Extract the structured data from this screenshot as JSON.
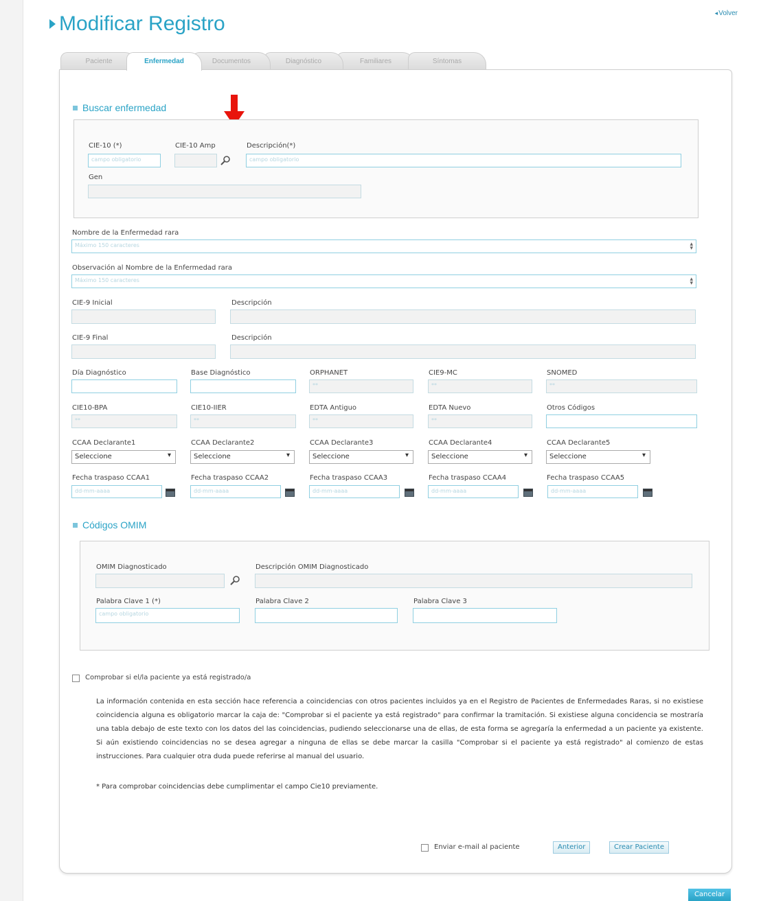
{
  "header": {
    "title": "Modificar Registro",
    "back_link": "Volver"
  },
  "tabs": [
    "Paciente",
    "Enfermedad",
    "Documentos",
    "Diagnóstico",
    "Familiares",
    "Síntomas"
  ],
  "buscar": {
    "section_title": "Buscar enfermedad",
    "cie10_label": "CIE-10 (*)",
    "cie10_placeholder": "campo obligatorio",
    "cie10amp_label": "CIE-10 Amp",
    "descripcion_label": "Descripción(*)",
    "descripcion_placeholder": "campo obligatorio",
    "gen_label": "Gen"
  },
  "form": {
    "nombre_label": "Nombre de la Enfermedad rara",
    "nombre_placeholder": "Máximo 150 caracteres",
    "observacion_label": "Observación al Nombre de la Enfermedad rara",
    "observacion_placeholder": "Máximo 150 caracteres",
    "cie9_inicial_label": "CIE-9 Inicial",
    "cie9_final_label": "CIE-9 Final",
    "descripcion_label": "Descripción",
    "row1": [
      "Día Diagnóstico",
      "Base Diagnóstico",
      "ORPHANET",
      "CIE9-MC",
      "SNOMED"
    ],
    "row1_values": [
      "",
      "",
      "**",
      "**",
      "**"
    ],
    "row2": [
      "CIE10-BPA",
      "CIE10-IIER",
      "EDTA Antiguo",
      "EDTA Nuevo",
      "Otros Códigos"
    ],
    "row2_values": [
      "**",
      "**",
      "**",
      "**",
      ""
    ],
    "ccaa_labels": [
      "CCAA Declarante1",
      "CCAA Declarante2",
      "CCAA Declarante3",
      "CCAA Declarante4",
      "CCAA Declarante5"
    ],
    "select_value": "Seleccione",
    "fecha_labels": [
      "Fecha traspaso CCAA1",
      "Fecha traspaso CCAA2",
      "Fecha traspaso CCAA3",
      "Fecha traspaso CCAA4",
      "Fecha traspaso CCAA5"
    ],
    "date_placeholder": "dd-mm-aaaa"
  },
  "omim": {
    "section_title": "Códigos OMIM",
    "diag_label": "OMIM Diagnosticado",
    "desc_label": "Descripción OMIM Diagnosticado",
    "clave1_label": "Palabra Clave 1 (*)",
    "clave1_placeholder": "campo obligatorio",
    "clave2_label": "Palabra Clave 2",
    "clave3_label": "Palabra Clave 3"
  },
  "check": {
    "label": "Comprobar si el/la paciente ya está registrado/a",
    "paragraph": "La información contenida en esta sección hace referencia a coincidencias con otros pacientes incluidos ya en el Registro de Pacientes de Enfermedades Raras, si no existiese coincidencia alguna es obligatorio marcar la caja de: \"Comprobar si el paciente ya está registrado\" para confirmar la tramitación. Si existiese alguna concidencia se mostraría una tabla debajo de este texto con los datos del las coincidencias, pudiendo seleccionarse una de ellas, de esta forma se agregaría la enfermedad a un paciente ya existente. Si aún existiendo coincidencias no se desea agregar a ninguna de ellas se debe marcar la casilla \"Comprobar si el paciente ya está registrado\" al comienzo de estas instrucciones. Para cualquier otra duda puede referirse al manual del usuario.",
    "note": "* Para comprobar coincidencias debe cumplimentar el campo Cie10 previamente."
  },
  "footer": {
    "email_label": "Enviar e-mail al paciente",
    "anterior": "Anterior",
    "crear": "Crear Paciente",
    "cancelar": "Cancelar"
  },
  "colors": {
    "accent": "#2aa3c6",
    "arrow": "#e8140c"
  }
}
